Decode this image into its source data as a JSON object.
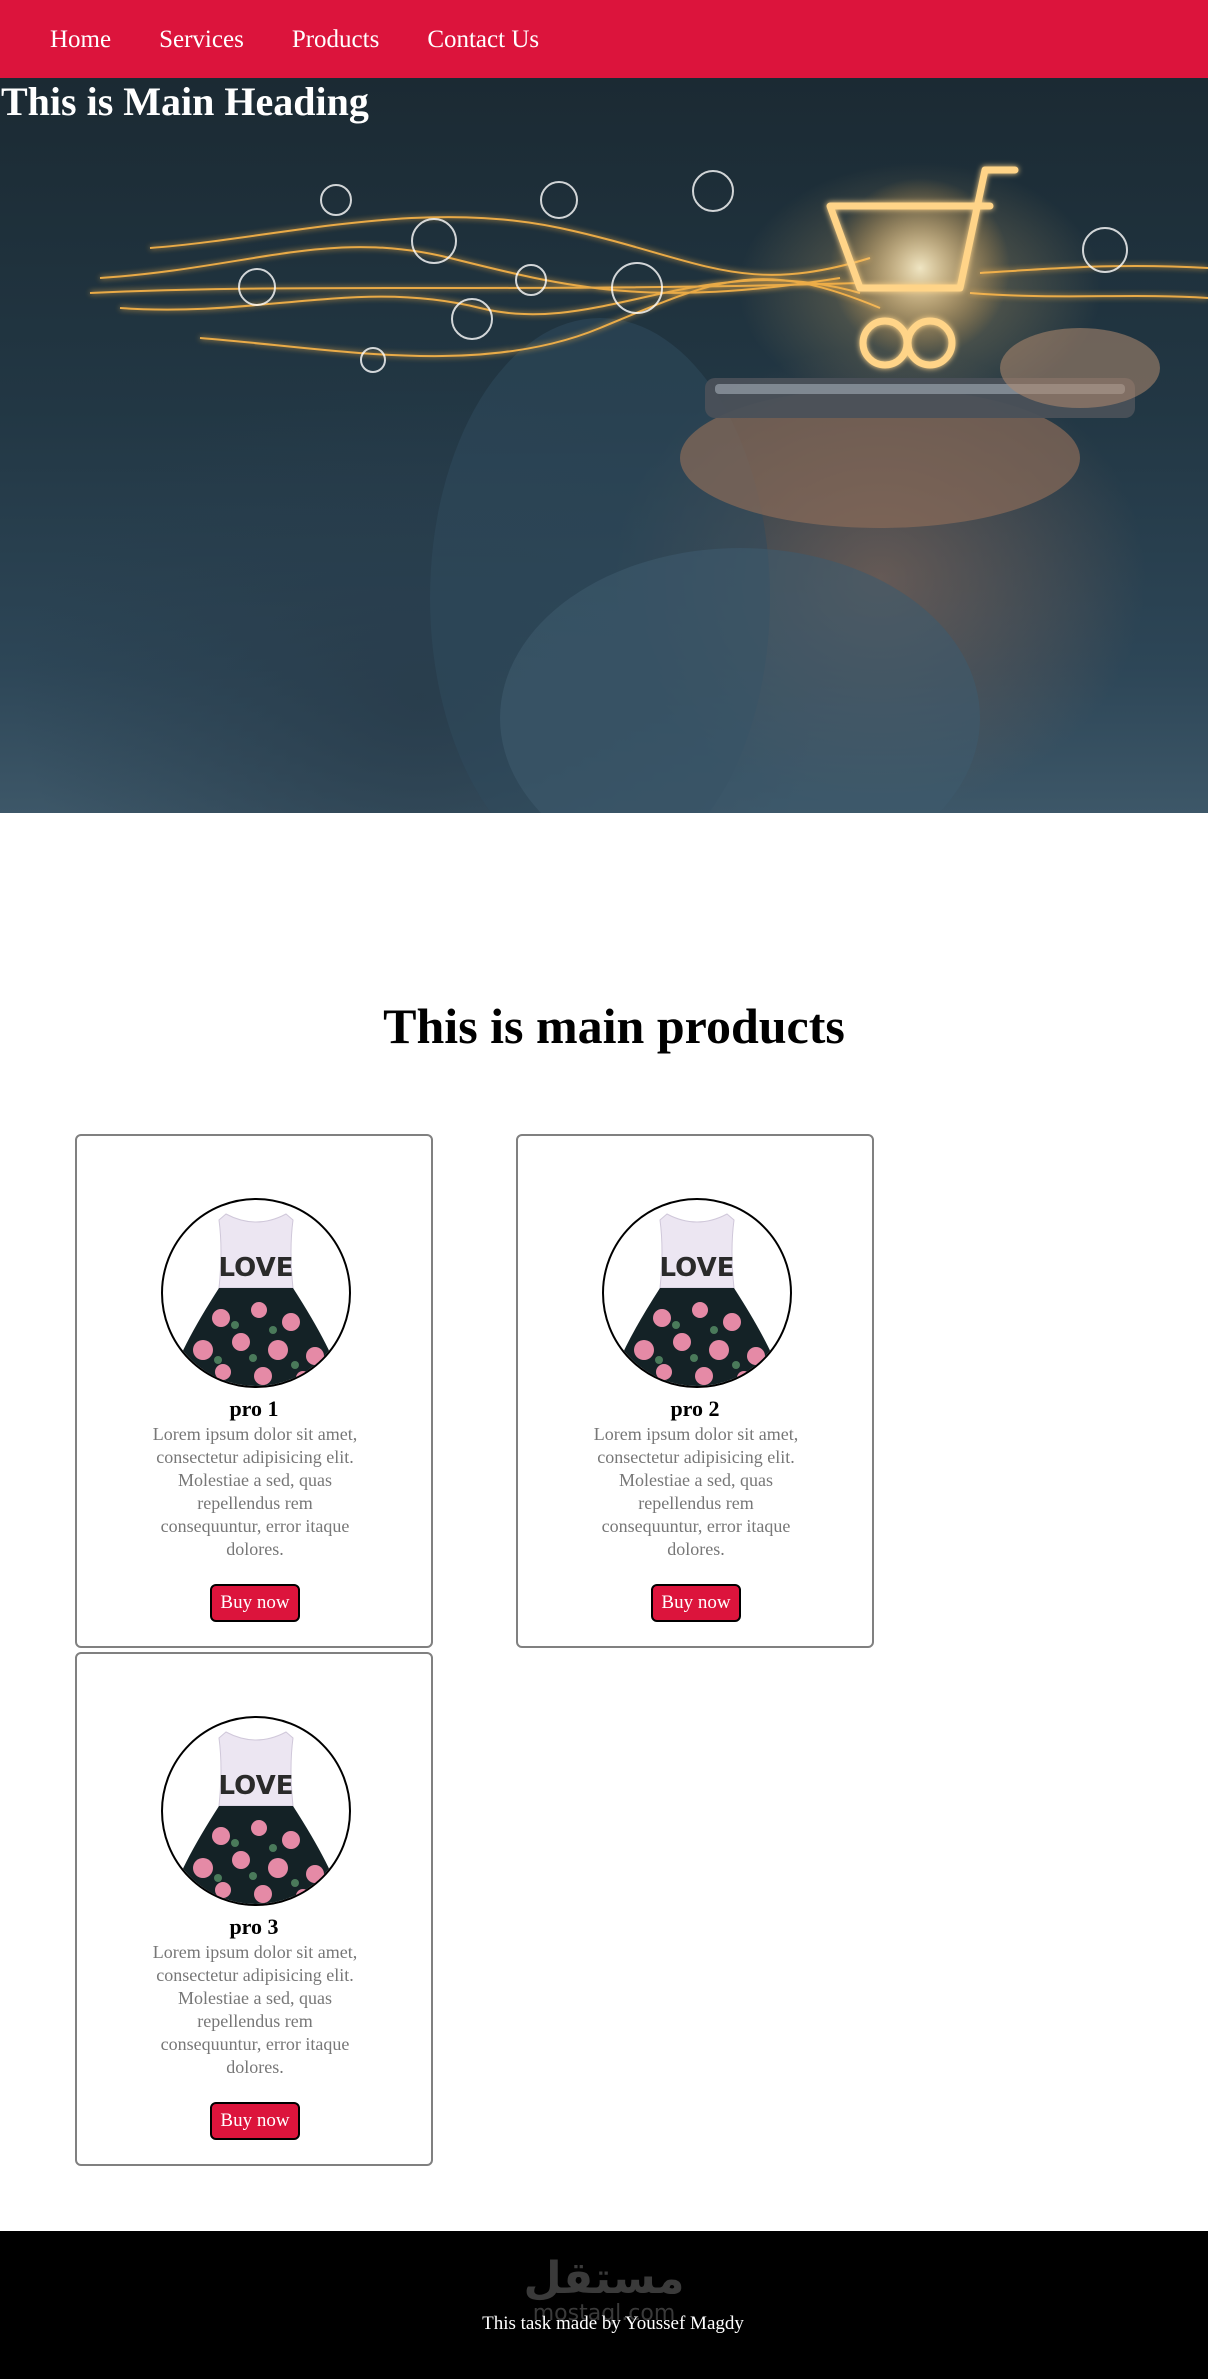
{
  "nav": {
    "items": [
      {
        "label": "Home"
      },
      {
        "label": "Services"
      },
      {
        "label": "Products"
      },
      {
        "label": "Contact Us"
      }
    ]
  },
  "hero": {
    "title": "This is Main Heading"
  },
  "products": {
    "title": "This is main products",
    "cards": [
      {
        "name": "pro 1",
        "description": "Lorem ipsum dolor sit amet, consectetur adipisicing elit. Molestiae a sed, quas repellendus rem consequuntur, error itaque dolores.",
        "button": "Buy now",
        "image_text": "LOVE"
      },
      {
        "name": "pro 2",
        "description": "Lorem ipsum dolor sit amet, consectetur adipisicing elit. Molestiae a sed, quas repellendus rem consequuntur, error itaque dolores.",
        "button": "Buy now",
        "image_text": "LOVE"
      },
      {
        "name": "pro 3",
        "description": "Lorem ipsum dolor sit amet, consectetur adipisicing elit. Molestiae a sed, quas repellendus rem consequuntur, error itaque dolores.",
        "button": "Buy now",
        "image_text": "LOVE"
      }
    ]
  },
  "footer": {
    "credit": "This task made by Youssef Magdy",
    "watermark": "مستقل",
    "watermark_sub": "mostaql.com"
  },
  "colors": {
    "accent": "#dc143c",
    "footer_bg": "#000000",
    "description_text": "#777777"
  }
}
